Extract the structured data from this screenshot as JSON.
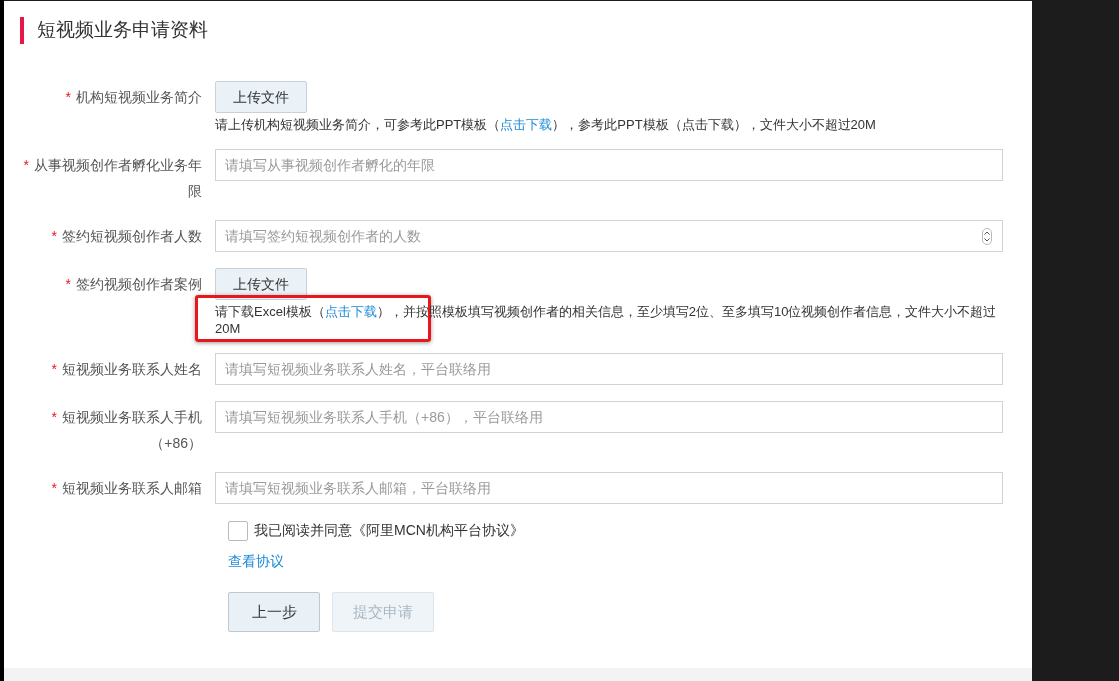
{
  "title": "短视频业务申请资料",
  "fields": [
    {
      "kind": "upload",
      "required_mark": "*",
      "label": "机构短视频业务简介",
      "button": "上传文件",
      "hint": [
        {
          "kind": "text",
          "text": "请上传机构短视频业务简介，可参考此PPT模板（"
        },
        {
          "kind": "link",
          "text": "点击下载"
        },
        {
          "kind": "text",
          "text": "），参考此PPT模板（点击下载），文件大小不超过20M"
        }
      ]
    },
    {
      "kind": "text",
      "required_mark": "*",
      "label": "从事视频创作者孵化业务年限",
      "placeholder": "请填写从事视频创作者孵化的年限"
    },
    {
      "kind": "number",
      "required_mark": "*",
      "label": "签约短视频创作者人数",
      "placeholder": "请填写签约短视频创作者的人数"
    },
    {
      "kind": "upload",
      "required_mark": "*",
      "label": "签约视频创作者案例",
      "button": "上传文件",
      "highlighted": true,
      "hint": [
        {
          "kind": "text",
          "text": "请下载Excel模板（"
        },
        {
          "kind": "link",
          "text": "点击下载"
        },
        {
          "kind": "text",
          "text": "），并按照模板填写视频创作者的相关信息，至少填写2位、至多填写10位视频创作者信息，文件大小不超过20M"
        }
      ]
    },
    {
      "kind": "text",
      "required_mark": "*",
      "label": "短视频业务联系人姓名",
      "placeholder": "请填写短视频业务联系人姓名，平台联络用"
    },
    {
      "kind": "text",
      "required_mark": "*",
      "label": "短视频业务联系人手机（+86）",
      "placeholder": "请填写短视频业务联系人手机（+86），平台联络用"
    },
    {
      "kind": "text",
      "required_mark": "*",
      "label": "短视频业务联系人邮箱",
      "placeholder": "请填写短视频业务联系人邮箱，平台联络用"
    }
  ],
  "agreement": {
    "checked": false,
    "text": "我已阅读并同意《阿里MCN机构平台协议》",
    "link": "查看协议"
  },
  "buttons": [
    {
      "label": "上一步",
      "disabled": false
    },
    {
      "label": "提交申请",
      "disabled": true
    }
  ]
}
